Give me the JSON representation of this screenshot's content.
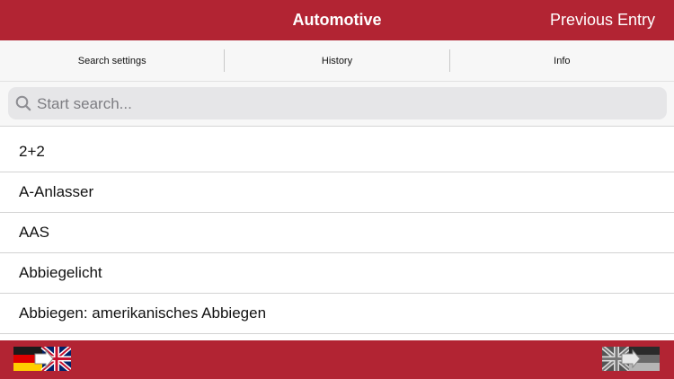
{
  "header": {
    "title": "Automotive",
    "previous_entry": "Previous Entry"
  },
  "segments": [
    {
      "label": "Search settings"
    },
    {
      "label": "History"
    },
    {
      "label": "Info"
    }
  ],
  "search": {
    "placeholder": "Start search...",
    "value": ""
  },
  "entries": [
    {
      "label": "2+2"
    },
    {
      "label": "A-Anlasser"
    },
    {
      "label": "AAS"
    },
    {
      "label": "Abbiegelicht"
    },
    {
      "label": "Abbiegen: amerikanisches Abbiegen"
    }
  ],
  "footer": {
    "left_button_icon": "german-to-english-flag-icon",
    "right_button_icon": "english-to-german-flag-icon"
  },
  "colors": {
    "accent": "#b22433"
  }
}
